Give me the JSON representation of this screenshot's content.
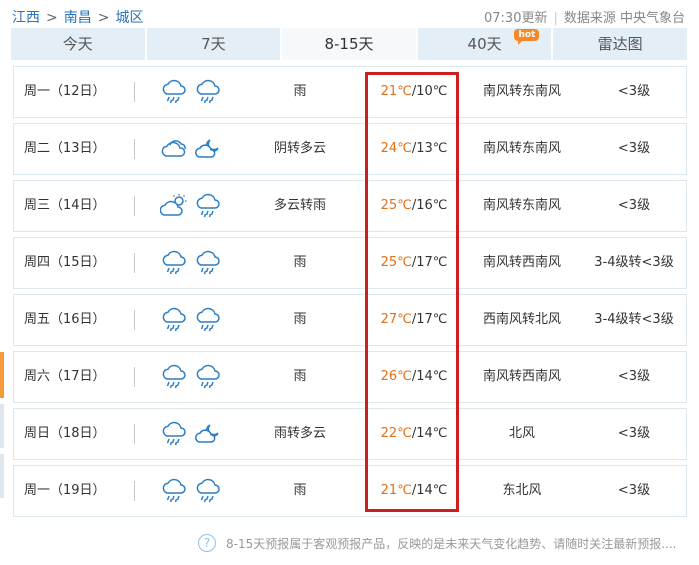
{
  "breadcrumb": {
    "province": "江西",
    "city": "南昌",
    "district": "城区",
    "separator": ">"
  },
  "meta": {
    "updated": "07:30更新",
    "source": "数据来源 中央气象台"
  },
  "tabs": [
    {
      "label": "今天",
      "active": false
    },
    {
      "label": "7天",
      "active": false
    },
    {
      "label": "8-15天",
      "active": true
    },
    {
      "label": "40天",
      "active": false,
      "badge": "hot"
    },
    {
      "label": "雷达图",
      "active": false
    }
  ],
  "colors": {
    "accent": "#2a73b8",
    "tab_bg": "#e4eef7",
    "temp_high": "#e2701b",
    "highlight": "#cc1f1f",
    "hot_badge": "#f4892a"
  },
  "forecast": [
    {
      "date": "周一（12日）",
      "icons": [
        "rain-cloud-icon",
        "rain-cloud-icon"
      ],
      "desc": "雨",
      "high": "21℃",
      "low": "/10℃",
      "wind": "南风转东南风",
      "level": "<3级"
    },
    {
      "date": "周二（13日）",
      "icons": [
        "cloudy-icon",
        "cloudy-night-icon"
      ],
      "desc": "阴转多云",
      "high": "24℃",
      "low": "/13℃",
      "wind": "南风转东南风",
      "level": "<3级"
    },
    {
      "date": "周三（14日）",
      "icons": [
        "partly-sunny-icon",
        "rain-cloud-icon"
      ],
      "desc": "多云转雨",
      "high": "25℃",
      "low": "/16℃",
      "wind": "南风转东南风",
      "level": "<3级"
    },
    {
      "date": "周四（15日）",
      "icons": [
        "rain-cloud-icon",
        "rain-cloud-icon"
      ],
      "desc": "雨",
      "high": "25℃",
      "low": "/17℃",
      "wind": "南风转西南风",
      "level": "3-4级转<3级"
    },
    {
      "date": "周五（16日）",
      "icons": [
        "rain-cloud-icon",
        "rain-cloud-icon"
      ],
      "desc": "雨",
      "high": "27℃",
      "low": "/17℃",
      "wind": "西南风转北风",
      "level": "3-4级转<3级"
    },
    {
      "date": "周六（17日）",
      "icons": [
        "rain-cloud-icon",
        "rain-cloud-icon"
      ],
      "desc": "雨",
      "high": "26℃",
      "low": "/14℃",
      "wind": "南风转西南风",
      "level": "<3级"
    },
    {
      "date": "周日（18日）",
      "icons": [
        "rain-cloud-icon",
        "cloudy-night-icon"
      ],
      "desc": "雨转多云",
      "high": "22℃",
      "low": "/14℃",
      "wind": "北风",
      "level": "<3级"
    },
    {
      "date": "周一（19日）",
      "icons": [
        "rain-cloud-icon",
        "rain-cloud-icon"
      ],
      "desc": "雨",
      "high": "21℃",
      "low": "/14℃",
      "wind": "东北风",
      "level": "<3级"
    }
  ],
  "footer": {
    "help_icon": "?",
    "note": "8-15天预报属于客观预报产品，反映的是未来天气变化趋势、请随时关注最新预报...."
  }
}
